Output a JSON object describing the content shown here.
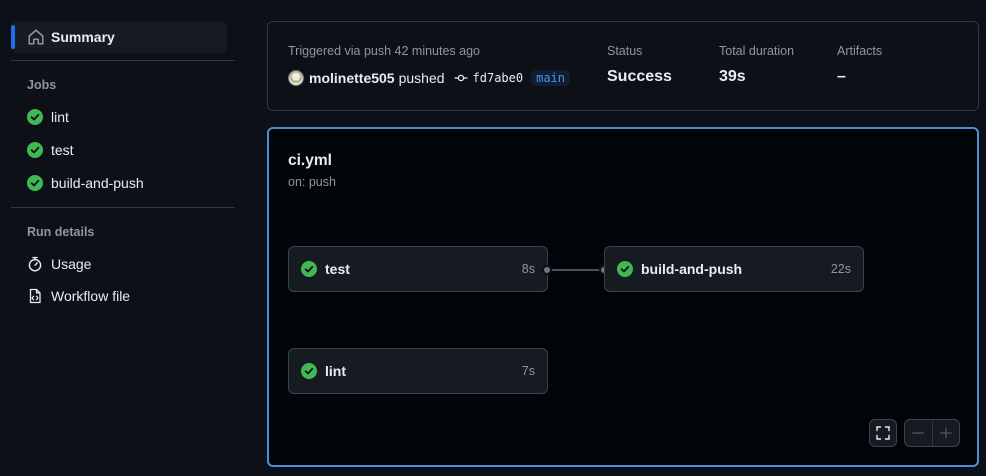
{
  "sidebar": {
    "summary_label": "Summary",
    "jobs_title": "Jobs",
    "jobs": [
      {
        "label": "lint"
      },
      {
        "label": "test"
      },
      {
        "label": "build-and-push"
      }
    ],
    "run_details_title": "Run details",
    "details": [
      {
        "label": "Usage",
        "icon": "stopwatch-icon"
      },
      {
        "label": "Workflow file",
        "icon": "file-code-icon"
      }
    ]
  },
  "summary": {
    "trigger_text": "Triggered via push 42 minutes ago",
    "actor": "molinette505",
    "actor_action": "pushed",
    "commit_sha": "fd7abe0",
    "branch": "main",
    "status_label": "Status",
    "status_value": "Success",
    "duration_label": "Total duration",
    "duration_value": "39s",
    "artifacts_label": "Artifacts",
    "artifacts_value": "–"
  },
  "workflow": {
    "file": "ci.yml",
    "trigger": "on: push",
    "jobs": [
      {
        "name": "test",
        "duration": "8s"
      },
      {
        "name": "build-and-push",
        "duration": "22s"
      },
      {
        "name": "lint",
        "duration": "7s"
      }
    ]
  },
  "colors": {
    "accent": "#1f6feb",
    "success": "#3fb950",
    "background": "#0d1117",
    "focus_border": "#4d8fd6"
  }
}
